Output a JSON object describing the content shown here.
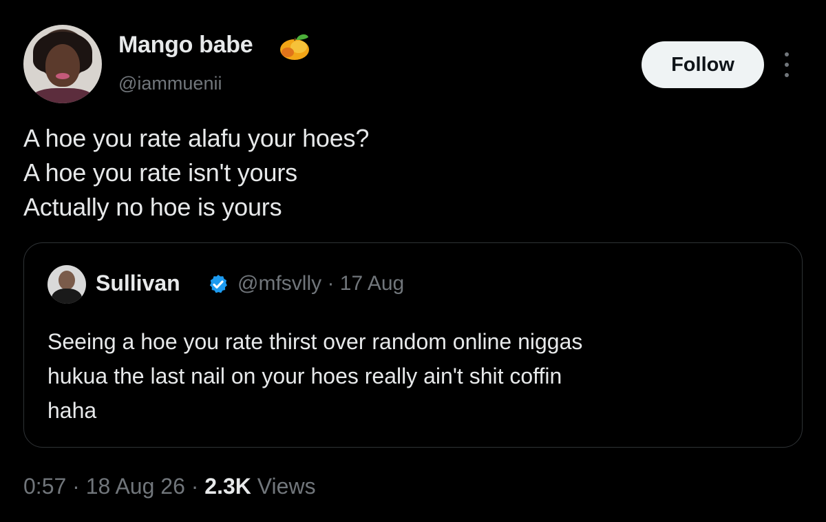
{
  "author": {
    "display_name": "Mango babe",
    "name_emoji": "mango-icon",
    "handle": "@iammuenii",
    "avatar_icon": "profile-photo"
  },
  "actions": {
    "follow_label": "Follow",
    "more_icon": "more-options-icon"
  },
  "tweet": {
    "lines": [
      "A hoe you rate alafu your hoes?",
      "A hoe you rate isn't yours",
      "Actually no hoe is yours"
    ]
  },
  "quoted_tweet": {
    "display_name": "Sullivan",
    "verified": true,
    "verified_color": "#1d9bf0",
    "meta": "@mfsvlly · 17 Aug",
    "lines": [
      "Seeing a hoe you rate thirst over random online niggas",
      "hukua the last nail on your hoes really ain't shit coffin",
      "haha"
    ]
  },
  "footer": {
    "time": "0:57",
    "separator": " · ",
    "date": "18 Aug 26",
    "views_count": "2.3K",
    "views_label": " Views"
  },
  "colors": {
    "background": "#000000",
    "primary_text": "#e7e9ea",
    "secondary_text": "#71767b",
    "border": "#2f3336",
    "button_bg": "#eff3f4"
  }
}
